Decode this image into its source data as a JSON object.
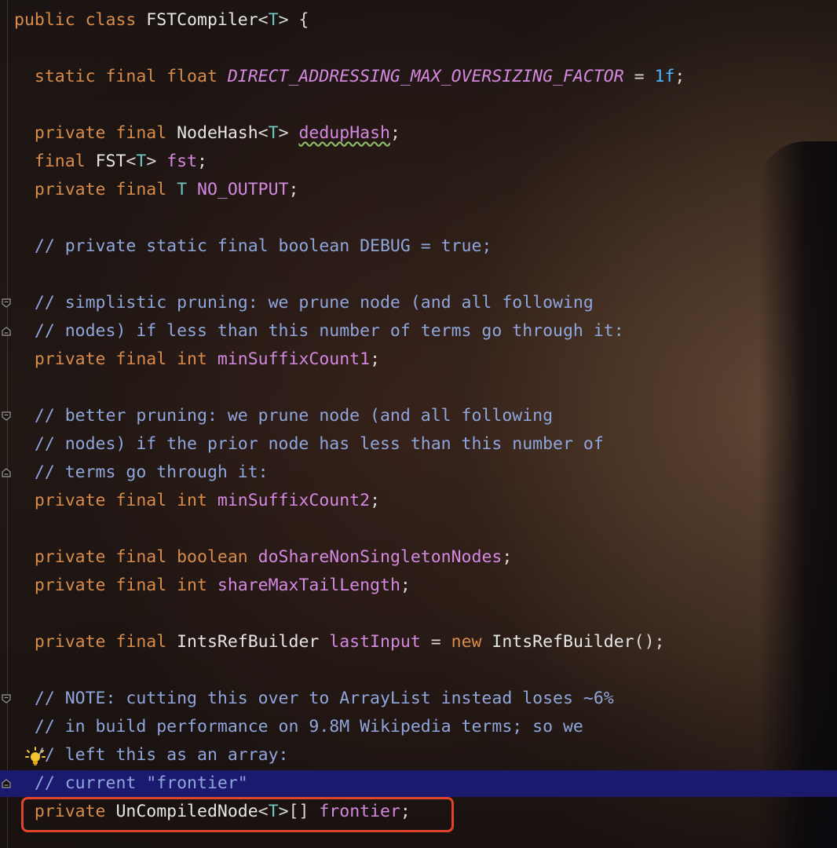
{
  "editor": {
    "lines": [
      {
        "segments": [
          {
            "t": "public class ",
            "c": "kw"
          },
          {
            "t": "FSTCompiler",
            "c": "type"
          },
          {
            "t": "<",
            "c": "plain"
          },
          {
            "t": "T",
            "c": "gen"
          },
          {
            "t": "> {",
            "c": "plain"
          }
        ]
      },
      {
        "segments": []
      },
      {
        "segments": [
          {
            "t": "  static final float ",
            "c": "kw"
          },
          {
            "t": "DIRECT_ADDRESSING_MAX_OVERSIZING_FACTOR",
            "c": "field-it"
          },
          {
            "t": " = ",
            "c": "plain"
          },
          {
            "t": "1f",
            "c": "num"
          },
          {
            "t": ";",
            "c": "plain"
          }
        ]
      },
      {
        "segments": []
      },
      {
        "segments": [
          {
            "t": "  private final ",
            "c": "kw"
          },
          {
            "t": "NodeHash",
            "c": "type"
          },
          {
            "t": "<",
            "c": "plain"
          },
          {
            "t": "T",
            "c": "gen"
          },
          {
            "t": "> ",
            "c": "plain"
          },
          {
            "t": "dedupHash",
            "c": "field squiggle"
          },
          {
            "t": ";",
            "c": "plain"
          }
        ]
      },
      {
        "segments": [
          {
            "t": "  final ",
            "c": "kw"
          },
          {
            "t": "FST",
            "c": "type"
          },
          {
            "t": "<",
            "c": "plain"
          },
          {
            "t": "T",
            "c": "gen"
          },
          {
            "t": "> ",
            "c": "plain"
          },
          {
            "t": "fst",
            "c": "field"
          },
          {
            "t": ";",
            "c": "plain"
          }
        ]
      },
      {
        "segments": [
          {
            "t": "  private final ",
            "c": "kw"
          },
          {
            "t": "T",
            "c": "gen"
          },
          {
            "t": " ",
            "c": "plain"
          },
          {
            "t": "NO_OUTPUT",
            "c": "field"
          },
          {
            "t": ";",
            "c": "plain"
          }
        ]
      },
      {
        "segments": []
      },
      {
        "segments": [
          {
            "t": "  // private static final boolean DEBUG = true;",
            "c": "cmt"
          }
        ]
      },
      {
        "segments": []
      },
      {
        "segments": [
          {
            "t": "  // simplistic pruning: we prune node (and all following",
            "c": "cmt"
          }
        ]
      },
      {
        "segments": [
          {
            "t": "  // nodes) if less than this number of terms go through it:",
            "c": "cmt"
          }
        ]
      },
      {
        "segments": [
          {
            "t": "  private final int ",
            "c": "kw"
          },
          {
            "t": "minSuffixCount1",
            "c": "field"
          },
          {
            "t": ";",
            "c": "plain"
          }
        ]
      },
      {
        "segments": []
      },
      {
        "segments": [
          {
            "t": "  // better pruning: we prune node (and all following",
            "c": "cmt"
          }
        ]
      },
      {
        "segments": [
          {
            "t": "  // nodes) if the prior node has less than this number of",
            "c": "cmt"
          }
        ]
      },
      {
        "segments": [
          {
            "t": "  // terms go through it:",
            "c": "cmt"
          }
        ]
      },
      {
        "segments": [
          {
            "t": "  private final int ",
            "c": "kw"
          },
          {
            "t": "minSuffixCount2",
            "c": "field"
          },
          {
            "t": ";",
            "c": "plain"
          }
        ]
      },
      {
        "segments": []
      },
      {
        "segments": [
          {
            "t": "  private final boolean ",
            "c": "kw"
          },
          {
            "t": "doShareNonSingletonNodes",
            "c": "field"
          },
          {
            "t": ";",
            "c": "plain"
          }
        ]
      },
      {
        "segments": [
          {
            "t": "  private final int ",
            "c": "kw"
          },
          {
            "t": "shareMaxTailLength",
            "c": "field"
          },
          {
            "t": ";",
            "c": "plain"
          }
        ]
      },
      {
        "segments": []
      },
      {
        "segments": [
          {
            "t": "  private final ",
            "c": "kw"
          },
          {
            "t": "IntsRefBuilder",
            "c": "type"
          },
          {
            "t": " ",
            "c": "plain"
          },
          {
            "t": "lastInput",
            "c": "field"
          },
          {
            "t": " = ",
            "c": "plain"
          },
          {
            "t": "new ",
            "c": "kw"
          },
          {
            "t": "IntsRefBuilder",
            "c": "type"
          },
          {
            "t": "();",
            "c": "plain"
          }
        ]
      },
      {
        "segments": []
      },
      {
        "segments": [
          {
            "t": "  // NOTE: cutting this over to ArrayList instead loses ~6%",
            "c": "cmt"
          }
        ]
      },
      {
        "segments": [
          {
            "t": "  // in build performance on 9.8M Wikipedia terms; so we",
            "c": "cmt"
          }
        ]
      },
      {
        "segments": [
          {
            "t": "  // left this as an array:",
            "c": "cmt"
          }
        ]
      },
      {
        "segments": [
          {
            "t": "  // current \"frontier\"",
            "c": "cmt"
          }
        ]
      },
      {
        "segments": [
          {
            "t": "  private ",
            "c": "kw"
          },
          {
            "t": "UnCompiledNode",
            "c": "type"
          },
          {
            "t": "<",
            "c": "plain"
          },
          {
            "t": "T",
            "c": "gen"
          },
          {
            "t": ">[] ",
            "c": "plain"
          },
          {
            "t": "frontier",
            "c": "field"
          },
          {
            "t": ";",
            "c": "plain"
          }
        ]
      }
    ],
    "fold_markers_line_indices": [
      10,
      11,
      14,
      16,
      24,
      27
    ],
    "intention_icon": "lightbulb-icon",
    "highlighted_line_index": 27,
    "boxed_line_index": 28,
    "colors": {
      "keyword": "#d98c4a",
      "type": "#e6e6e6",
      "generic": "#6ec7c0",
      "field": "#d488e0",
      "number": "#4fb3ff",
      "comment": "#8fa6dc",
      "highlight_background": "#1c1a6e",
      "annotation_box": "#e0452a"
    }
  }
}
